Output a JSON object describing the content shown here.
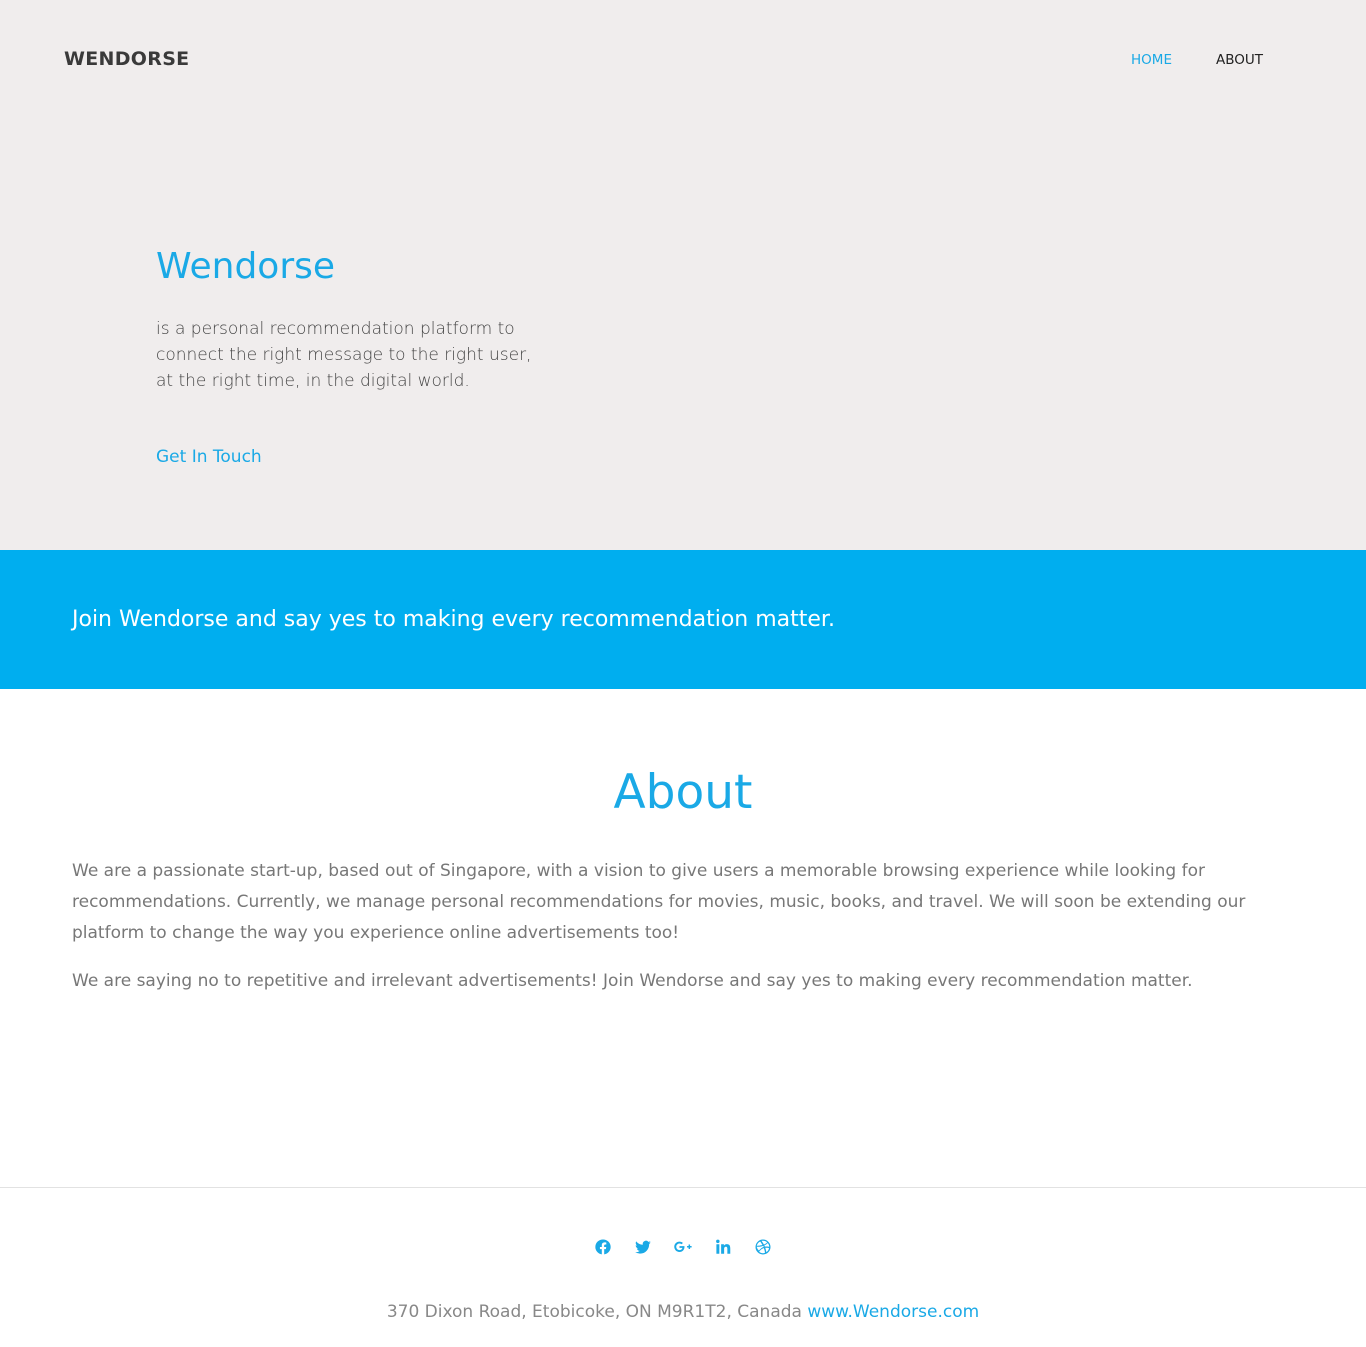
{
  "header": {
    "brand": "WENDORSE",
    "nav": {
      "home": "HOME",
      "about": "ABOUT"
    }
  },
  "hero": {
    "title": "Wendorse",
    "description": "is a personal recommendation platform to connect the right message to the right user, at the right time, in the digital world.",
    "cta": "Get In Touch"
  },
  "banner": {
    "text": "Join Wendorse and say yes to making every recommendation matter."
  },
  "about": {
    "title": "About",
    "paragraphs": [
      "We are a passionate start-up, based out of Singapore, with a vision to give users a memorable browsing experience while looking for recommendations. Currently, we manage personal recommendations for movies, music, books, and travel. We will soon be extending our platform to change the way you experience online advertisements too!",
      "We are saying no to repetitive and irrelevant advertisements! Join Wendorse and say yes to making every recommendation matter."
    ]
  },
  "footer": {
    "social_icons": [
      "facebook-icon",
      "twitter-icon",
      "google-plus-icon",
      "linkedin-icon",
      "dribbble-icon"
    ],
    "address": "370 Dixon Road, Etobicoke, ON M9R1T2, Canada",
    "website": "www.Wendorse.com"
  },
  "colors": {
    "accent": "#1aa9e6",
    "banner": "#00aeef",
    "hero_bg": "#f0eded"
  }
}
